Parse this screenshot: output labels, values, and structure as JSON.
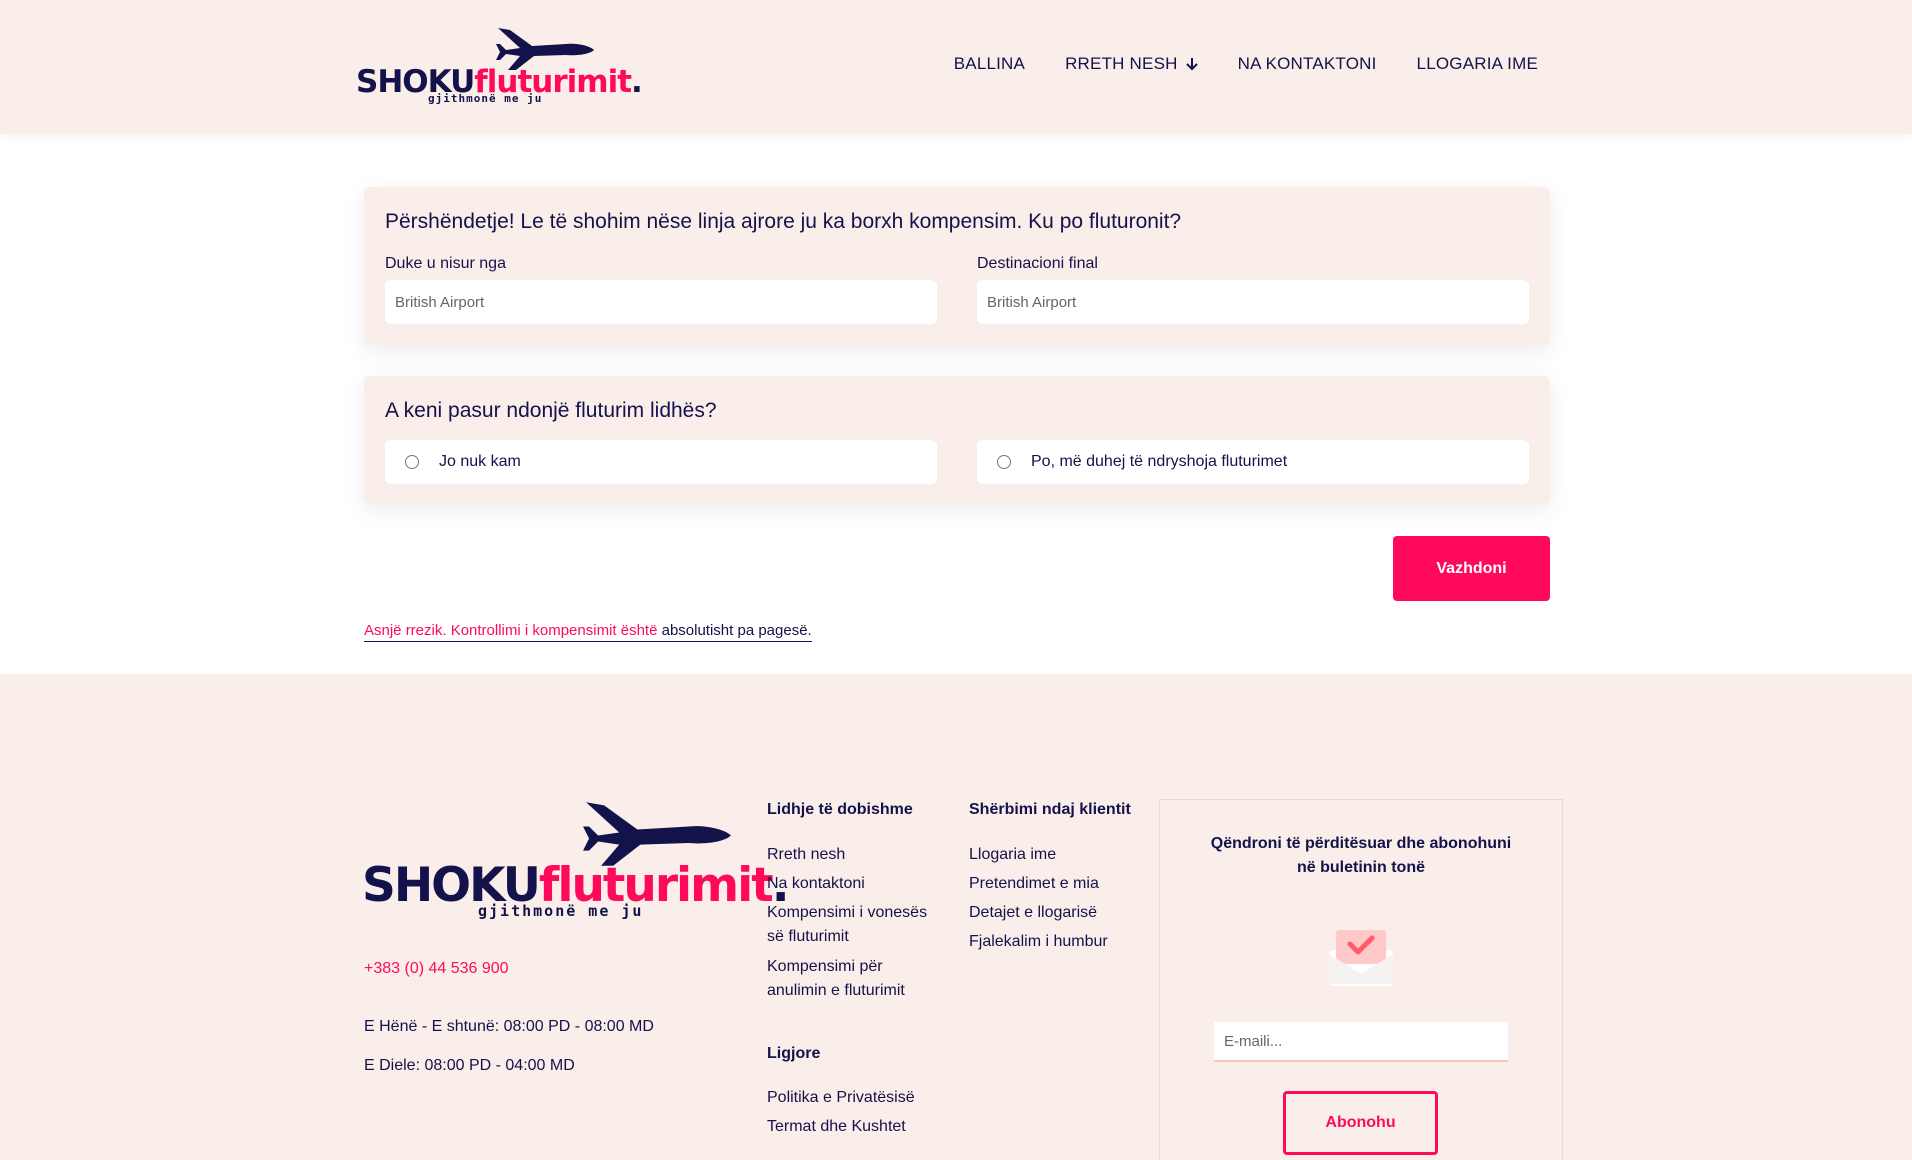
{
  "brand": {
    "name_part1": "SHOKU",
    "name_part2": "fluturimit",
    "name_dot": ".",
    "tagline": "gjithmonë me ju"
  },
  "nav": {
    "items": [
      {
        "label": "BALLINA"
      },
      {
        "label": "RRETH NESH",
        "has_dropdown": true
      },
      {
        "label": "NA KONTAKTONI"
      },
      {
        "label": "LLOGARIA IME"
      }
    ]
  },
  "flight_card": {
    "question": "Përshëndetje! Le të shohim nëse linja ajrore ju ka borxh kompensim. Ku po fluturonit?",
    "departure_label": "Duke u nisur nga",
    "departure_placeholder": "British Airport",
    "destination_label": "Destinacioni final",
    "destination_placeholder": "British Airport"
  },
  "connection_card": {
    "question": "A keni pasur ndonjë fluturim lidhës?",
    "option_no": "Jo nuk kam",
    "option_yes": "Po, më duhej të ndryshoja fluturimet"
  },
  "continue_button": "Vazhdoni",
  "risk_note": {
    "part1": "Asnjë rrezik. Kontrollimi i kompensimit është ",
    "part2": "absolutisht pa pagesë."
  },
  "footer": {
    "phone": "+383 (0) 44 536 900",
    "hours_weekdays": "E Hënë - E shtunë: 08:00 PD - 08:00 MD",
    "hours_sunday": "E Diele: 08:00 PD - 04:00 MD",
    "useful_links": {
      "heading": "Lidhje të dobishme",
      "items": [
        "Rreth nesh",
        "Na kontaktoni",
        "Kompensimi i vonesës së fluturimit",
        "Kompensimi për anulimin e fluturimit"
      ]
    },
    "legal": {
      "heading": "Ligjore",
      "items": [
        "Politika e Privatësisë",
        "Termat dhe Kushtet"
      ]
    },
    "customer_service": {
      "heading": "Shërbimi ndaj klientit",
      "items": [
        "Llogaria ime",
        "Pretendimet e mia",
        "Detajet e llogarisë",
        "Fjalekalim i humbur"
      ]
    },
    "newsletter": {
      "title": "Qëndroni të përditësuar dhe abonohuni në buletinin tonë",
      "email_placeholder": "E-maili...",
      "button": "Abonohu"
    }
  },
  "colors": {
    "accent": "#ff0a5a",
    "navy": "#14124a",
    "panel": "#f9eeea"
  }
}
